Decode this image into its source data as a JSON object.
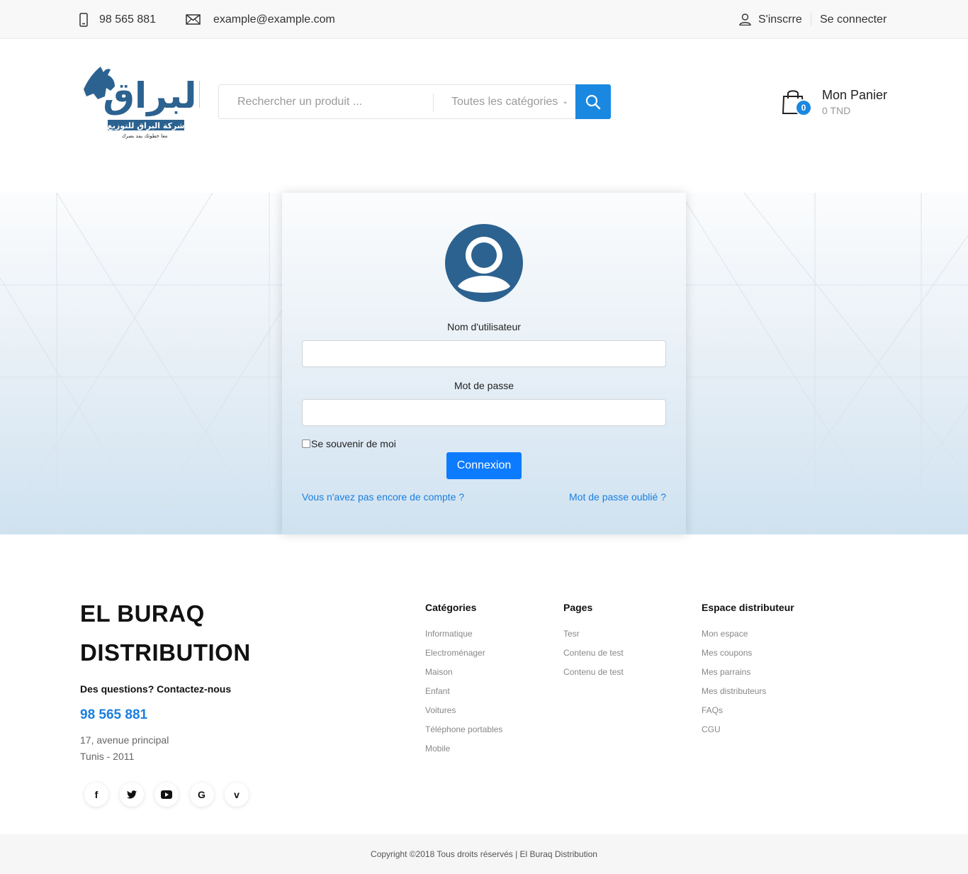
{
  "topbar": {
    "phone": "98 565 881",
    "email": "example@example.com",
    "register": "S'inscrre",
    "login": "Se connecter",
    "icons": [
      "phone-icon",
      "mail-icon",
      "user-icon"
    ]
  },
  "header": {
    "logo_text": "البراق",
    "logo_tagline": "شركة البراق للتوزيع",
    "logo_slogan": "معا خطوتك يمد بصرك",
    "search_placeholder": "Rechercher un produit ...",
    "category_select": "Toutes les catégories",
    "cart_count": "0",
    "cart_title": "Mon Panier",
    "cart_total": "0 TND"
  },
  "login": {
    "username_label": "Nom d'utilisateur",
    "password_label": "Mot de passe",
    "remember_label": "Se souvenir de moi",
    "submit_label": "Connexion",
    "no_account_link": "Vous n'avez pas encore de compte ?",
    "forgot_link": "Mot de passe oublié ?"
  },
  "footer": {
    "brand": "EL BURAQ DISTRIBUTION",
    "question": "Des questions? Contactez-nous",
    "phone": "98 565 881",
    "address_line1": "17, avenue principal",
    "address_line2": "Tunis - 2011",
    "social": [
      {
        "name": "facebook-icon",
        "glyph": "f"
      },
      {
        "name": "twitter-icon",
        "glyph": "t"
      },
      {
        "name": "youtube-icon",
        "glyph": "▶"
      },
      {
        "name": "google-icon",
        "glyph": "G"
      },
      {
        "name": "vimeo-icon",
        "glyph": "v"
      }
    ],
    "columns": [
      {
        "title": "Catégories",
        "items": [
          "Informatique",
          "Electroménager",
          "Maison",
          "Enfant",
          "Voitures",
          "Téléphone portables",
          "Mobile"
        ]
      },
      {
        "title": "Pages",
        "items": [
          "Tesr",
          "Contenu de test",
          "Contenu de test"
        ]
      },
      {
        "title": "Espace distributeur",
        "items": [
          "Mon espace",
          "Mes coupons",
          "Mes parrains",
          "Mes distributeurs",
          "FAQs",
          "CGU"
        ]
      }
    ],
    "copyright": "Copyright ©2018 Tous droits réservés | El Buraq Distribution"
  },
  "colors": {
    "accent": "#1a88e0",
    "button": "#0d7bff",
    "avatar": "#2c6290",
    "link": "#1a7fe0"
  }
}
